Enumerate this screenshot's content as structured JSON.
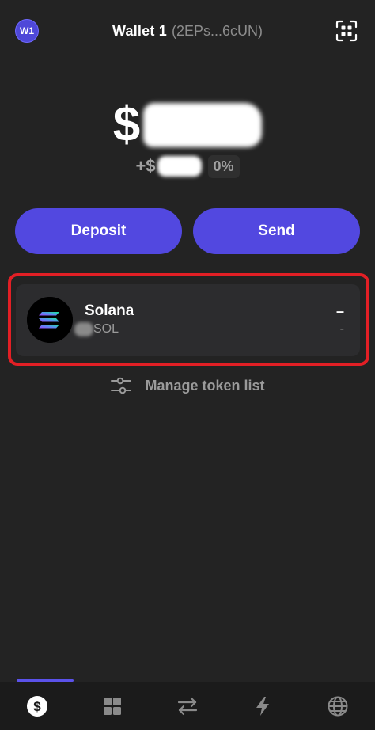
{
  "header": {
    "avatar_label": "W1",
    "wallet_name": "Wallet 1",
    "wallet_address": "(2EPs...6cUN)"
  },
  "balance": {
    "currency_symbol": "$",
    "change_prefix": "+$",
    "change_percent": "0%"
  },
  "actions": {
    "deposit_label": "Deposit",
    "send_label": "Send"
  },
  "tokens": [
    {
      "name": "Solana",
      "symbol": "SOL",
      "value": "–",
      "change": "-"
    }
  ],
  "manage": {
    "label": "Manage token list"
  },
  "bottom_nav": {
    "active": "dollar-icon",
    "items": [
      "dollar-icon",
      "grid-icon",
      "swap-icon",
      "lightning-icon",
      "globe-icon"
    ]
  },
  "colors": {
    "background": "#232323",
    "accent": "#5248e0",
    "highlight": "#e21f25",
    "card": "#2c2c2e"
  }
}
